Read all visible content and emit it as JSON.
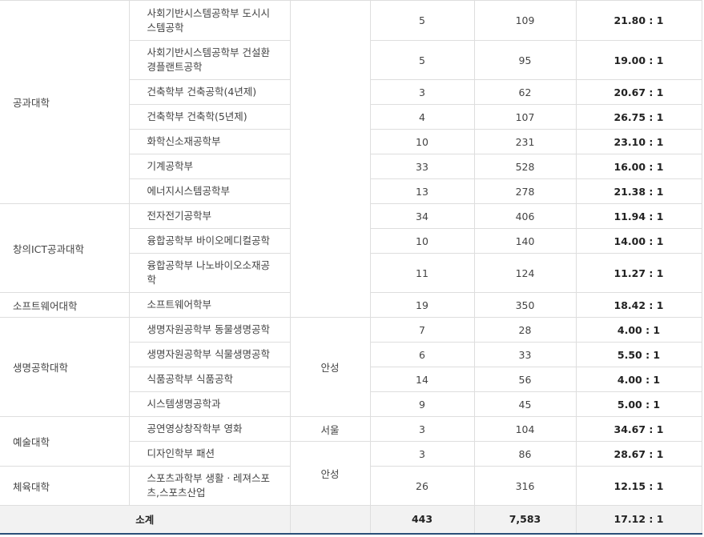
{
  "rows": [
    {
      "college": "공과대학",
      "dept": "사회기반시스템공학부 도시시스템공학",
      "quota": "5",
      "applicants": "109",
      "ratio": "21.80 : 1"
    },
    {
      "dept": "사회기반시스템공학부 건설환경플랜트공학",
      "quota": "5",
      "applicants": "95",
      "ratio": "19.00 : 1"
    },
    {
      "dept": "건축학부 건축공학(4년제)",
      "quota": "3",
      "applicants": "62",
      "ratio": "20.67 : 1"
    },
    {
      "dept": "건축학부 건축학(5년제)",
      "quota": "4",
      "applicants": "107",
      "ratio": "26.75 : 1"
    },
    {
      "dept": "화학신소재공학부",
      "quota": "10",
      "applicants": "231",
      "ratio": "23.10 : 1"
    },
    {
      "dept": "기계공학부",
      "quota": "33",
      "applicants": "528",
      "ratio": "16.00 : 1"
    },
    {
      "dept": "에너지시스템공학부",
      "quota": "13",
      "applicants": "278",
      "ratio": "21.38 : 1"
    },
    {
      "college": "창의ICT공과대학",
      "dept": "전자전기공학부",
      "quota": "34",
      "applicants": "406",
      "ratio": "11.94 : 1"
    },
    {
      "dept": "융합공학부 바이오메디컬공학",
      "quota": "10",
      "applicants": "140",
      "ratio": "14.00 : 1"
    },
    {
      "dept": "융합공학부 나노바이오소재공학",
      "quota": "11",
      "applicants": "124",
      "ratio": "11.27 : 1"
    },
    {
      "college": "소프트웨어대학",
      "dept": "소프트웨어학부",
      "quota": "19",
      "applicants": "350",
      "ratio": "18.42 : 1"
    },
    {
      "college": "생명공학대학",
      "campus": "안성",
      "dept": "생명자원공학부 동물생명공학",
      "quota": "7",
      "applicants": "28",
      "ratio": "4.00 : 1"
    },
    {
      "dept": "생명자원공학부 식물생명공학",
      "quota": "6",
      "applicants": "33",
      "ratio": "5.50 : 1"
    },
    {
      "dept": "식품공학부 식품공학",
      "quota": "14",
      "applicants": "56",
      "ratio": "4.00 : 1"
    },
    {
      "dept": "시스템생명공학과",
      "quota": "9",
      "applicants": "45",
      "ratio": "5.00 : 1"
    },
    {
      "college": "예술대학",
      "campus": "서울",
      "dept": "공연영상창작학부 영화",
      "quota": "3",
      "applicants": "104",
      "ratio": "34.67 : 1"
    },
    {
      "campus": "안성",
      "dept": "디자인학부 패션",
      "quota": "3",
      "applicants": "86",
      "ratio": "28.67 : 1"
    },
    {
      "college": "체육대학",
      "dept": "스포츠과학부 생활ㆍ레져스포츠,스포츠산업",
      "quota": "26",
      "applicants": "316",
      "ratio": "12.15 : 1"
    }
  ],
  "total": {
    "label": "소계",
    "campus": "",
    "quota": "443",
    "applicants": "7,583",
    "ratio": "17.12 : 1"
  }
}
